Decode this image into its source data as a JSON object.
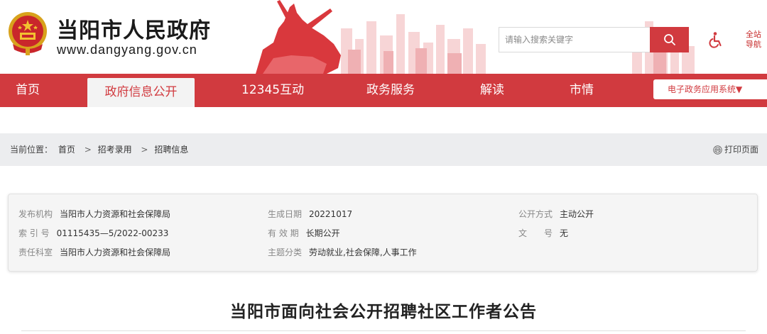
{
  "header": {
    "site_title": "当阳市人民政府",
    "site_url": "www.dangyang.gov.cn",
    "search_placeholder": "请输入搜索关键字",
    "site_nav_label_line1": "全站",
    "site_nav_label_line2": "导航"
  },
  "nav": {
    "items": [
      {
        "label": "首页"
      },
      {
        "label": "政府信息公开"
      },
      {
        "label": "12345互动"
      },
      {
        "label": "政务服务"
      },
      {
        "label": "解读"
      },
      {
        "label": "市情"
      }
    ],
    "active_index": 1,
    "dropdown_label": "电子政务应用系统▼"
  },
  "breadcrumb": {
    "prefix": "当前位置：",
    "items": [
      "首页",
      "招考录用",
      "招聘信息"
    ],
    "separator": ">",
    "print_label": "打印页面"
  },
  "info": {
    "publisher_label": "发布机构",
    "publisher_value": "当阳市人力资源和社会保障局",
    "date_label": "生成日期",
    "date_value": "20221017",
    "mode_label": "公开方式",
    "mode_value": "主动公开",
    "index_label": "索 引 号",
    "index_value": "01115435—5/2022-00233",
    "valid_label": "有 效 期",
    "valid_value": "长期公开",
    "docno_label": "文　　号",
    "docno_value": "无",
    "dept_label": "责任科室",
    "dept_value": "当阳市人力资源和社会保障局",
    "topic_label": "主题分类",
    "topic_value": "劳动就业,社会保障,人事工作"
  },
  "article": {
    "title": "当阳市面向社会公开招聘社区工作者公告"
  },
  "colors": {
    "brand_red": "#d13a3f",
    "breadcrumb_bg": "#ecedef"
  }
}
